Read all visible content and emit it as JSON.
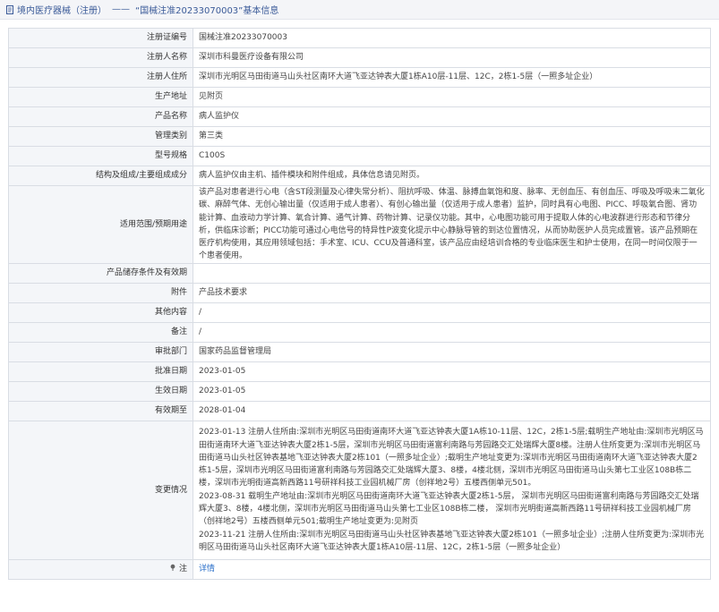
{
  "header": {
    "category": "境内医疗器械（注册）",
    "dash": "——",
    "title": "“国械注准20233070003”基本信息"
  },
  "rows": [
    {
      "label": "注册证编号",
      "value": "国械注准20233070003"
    },
    {
      "label": "注册人名称",
      "value": "深圳市科曼医疗设备有限公司"
    },
    {
      "label": "注册人住所",
      "value": "深圳市光明区马田街道马山头社区南环大道飞亚达钟表大厦1栋A10层-11层、12C，2栋1-5层（一照多址企业）"
    },
    {
      "label": "生产地址",
      "value": "见附页"
    },
    {
      "label": "产品名称",
      "value": "病人监护仪"
    },
    {
      "label": "管理类别",
      "value": "第三类"
    },
    {
      "label": "型号规格",
      "value": "C100S"
    },
    {
      "label": "结构及组成/主要组成成分",
      "value": "病人监护仪由主机、插件模块和附件组成，具体信息请见附页。"
    },
    {
      "label": "适用范围/预期用途",
      "value": "该产品对患者进行心电（含ST段测量及心律失常分析）、阻抗呼吸、体温、脉搏血氧饱和度、脉率、无创血压、有创血压、呼吸及呼吸末二氧化碳、麻醉气体、无创心输出量（仅适用于成人患者）、有创心输出量（仅适用于成人患者）监护，同时具有心电图、PICC、呼吸氧合图、肾功能计算、血液动力学计算、氧合计算、通气计算、药物计算、记录仪功能。其中，心电图功能可用于提取人体的心电波群进行形态和节律分析，供临床诊断；PICC功能可通过心电信号的特异性P波变化提示中心静脉导管的到达位置情况，从而协助医护人员完成置管。该产品预期在医疗机构使用，其应用领域包括：手术室、ICU、CCU及普通科室，该产品应由经培训合格的专业临床医生和护士使用，在同一时间仅限于一个患者使用。"
    },
    {
      "label": "产品储存条件及有效期",
      "value": ""
    },
    {
      "label": "附件",
      "value": "产品技术要求"
    },
    {
      "label": "其他内容",
      "value": "/"
    },
    {
      "label": "备注",
      "value": "/"
    },
    {
      "label": "审批部门",
      "value": "国家药品监督管理局"
    },
    {
      "label": "批准日期",
      "value": "2023-01-05"
    },
    {
      "label": "生效日期",
      "value": "2023-01-05"
    },
    {
      "label": "有效期至",
      "value": "2028-01-04"
    },
    {
      "label": "变更情况",
      "value": "2023-01-13 注册人住所由:深圳市光明区马田街道南环大道飞亚达钟表大厦1A栋10-11层、12C，2栋1-5层;载明生产地址由:深圳市光明区马田街道南环大道飞亚达钟表大厦2栋1-5层，深圳市光明区马田街道富利南路与芳园路交汇处瑞辉大厦8楼。注册人住所变更为:深圳市光明区马田街道马山头社区钟表基地飞亚达钟表大厦2栋101（一照多址企业）;载明生产地址变更为:深圳市光明区马田街道南环大道飞亚达钟表大厦2栋1-5层，深圳市光明区马田街道富利南路与芳园路交汇处瑞辉大厦3、8楼，4楼北侧，深圳市光明区马田街道马山头第七工业区108B栋二楼，深圳市光明街道高新西路11号研祥科技工业园机械厂房（创祥地2号）五楼西侧单元501。\n2023-08-31 载明生产地址由:深圳市光明区马田街道南环大道飞亚达钟表大厦2栋1-5层， 深圳市光明区马田街道富利南路与芳园路交汇处瑞辉大厦3、8楼，4楼北侧，深圳市光明区马田街道马山头第七工业区108B栋二楼， 深圳市光明街道高新西路11号研祥科技工业园机械厂房（创祥地2号）五楼西侧单元501;载明生产地址变更为:见附页\n2023-11-21 注册人住所由:深圳市光明区马田街道马山头社区钟表基地飞亚达钟表大厦2栋101（一照多址企业）;注册人住所变更为:深圳市光明区马田街道马山头社区南环大道飞亚达钟表大厦1栋A10层-11层、12C，2栋1-5层（一照多址企业）"
    },
    {
      "label": "注",
      "value": "详情",
      "is_link": true
    }
  ],
  "icons": {
    "header_icon": "document-icon",
    "note_icon": "pin-icon"
  },
  "colors": {
    "header_text": "#3a5a98",
    "link": "#2a6fc9",
    "label_bg": "#f4f6f9",
    "border": "#d9dde4"
  }
}
